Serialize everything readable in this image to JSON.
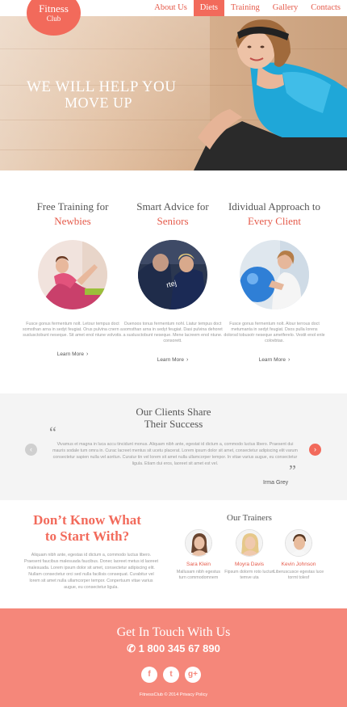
{
  "logo": {
    "line1": "Fitness",
    "line2": "Club"
  },
  "nav": [
    {
      "label": "About Us",
      "active": false
    },
    {
      "label": "Diets",
      "active": true
    },
    {
      "label": "Training",
      "active": false
    },
    {
      "label": "Gallery",
      "active": false
    },
    {
      "label": "Contacts",
      "active": false
    }
  ],
  "hero": {
    "line1": "WE WILL HELP YOU",
    "line2": "MOVE UP"
  },
  "features": [
    {
      "title1": "Free Training for",
      "title2": "Newbies",
      "desc": "Fusce gonus fermentum nolt. Letour tempus doct somsthan arna in sedyt feugiat. Orus pulvina cnern a suslusctobunt neseque. Sit amet enol ntune volvotis.",
      "more": "Learn More"
    },
    {
      "title1": "Smart Advice for",
      "title2": "Seniors",
      "desc": "Ouenoos tonus fermentum nohl. Liatur tempus doct somsthan arna in sedyt feugiat. Dasi pulvina dehoret a suslusctobunt neseque. Mene lacreem enol ntune. consorett.",
      "more": "Learn More"
    },
    {
      "title1": "Idividual Approach to",
      "title2": "Every Client",
      "desc": "Fusce gonus fermentum nolt. Alour terrous doct metumanta in sedyt feugiat. Dsos pulla lorens dolorsd tobusotr neseque ametferelo. Vestit enol enle colovbtas.",
      "more": "Learn More"
    }
  ],
  "testimonial": {
    "heading1": "Our Clients Share",
    "heading2": "Their Success",
    "body": "Vivamus et magna in luca accu tincidunt monus. Aliquam nibh ante, egestat id dictum a, commodo luctus libero. Praesent dui mauris sodale tum omra in. Curac lacreet mentus sit ucetu placerat. Lorem ipsum dolor sit amet, consectetur adipiscing elit varum consectetur sapien nulla vel aoritun. Curatur tin vel lorem sit amet nulla ullamcorper tempor. In vitae varius augue, eu consectetur ligula. Etiam dui eros, laoreet sit amet est vel.",
    "author": "Irma Grey",
    "prev": "‹",
    "next": "›"
  },
  "cta": {
    "line1": "Don’t Know What",
    "line2": "to Start With?",
    "body": "Aliquam nibh ante, egestas id dictum a, commodo luctus libero. Praesent faucibus malesuada faucibus. Donec laoreet metus id laoreet malesuada. Lorem ipsum dolor sit amet, consectetur adipiscing elit. Nullam consectetur orci sed nulla facilisis consequat. Curabitur vel lorem sit amet nulla ullamcorper tempor. Conpertuum vitae varius augue, eu consectetur ligula."
  },
  "trainers": {
    "title": "Our Trainers",
    "people": [
      {
        "name": "Sara Klein",
        "role": "Mallusam nibh egestus turn commodomnem"
      },
      {
        "name": "Moyra Davis",
        "role": "Fipsum dolorm roto lucturt temve uta"
      },
      {
        "name": "Kevin Johnson",
        "role": "Liberuscusce egestas luce tormt tolesf"
      }
    ]
  },
  "footer": {
    "heading": "Get In Touch With Us",
    "phone": "1 800 345 67 890",
    "socials": [
      "f",
      "t",
      "g+"
    ],
    "copyright": "FitnessClub © 2014 Privacy Policy"
  },
  "colors": {
    "accent": "#f26a5b",
    "footer_bg": "#f5877a"
  }
}
